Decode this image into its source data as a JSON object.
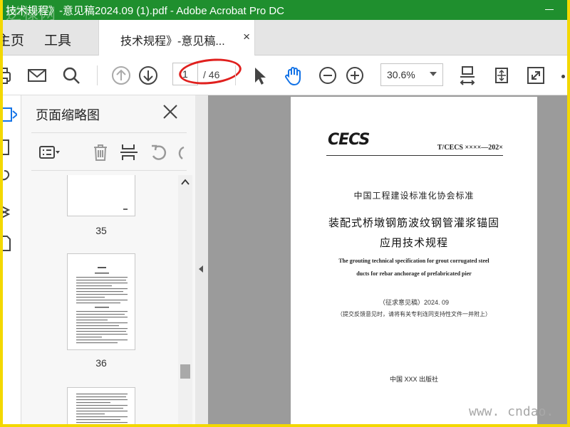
{
  "window": {
    "title": "技术规程》-意见稿2024.09 (1).pdf - Adobe Acrobat Pro DC",
    "watermark_top": "逆棣网"
  },
  "tabs": {
    "home": "主页",
    "tools": "工具",
    "document": "技术规程》-意见稿...",
    "close": "×"
  },
  "toolbar": {
    "current_page": "1",
    "total_pages": "/ 46",
    "zoom": "30.6%"
  },
  "thumbnail_panel": {
    "title": "页面缩略图",
    "pages": [
      {
        "number": "35"
      },
      {
        "number": "36"
      },
      {
        "number": ""
      }
    ]
  },
  "document": {
    "logo": "CECS",
    "standard_code": "T/CECS ××××—202×",
    "organization": "中国工程建设标准化协会标准",
    "title_line1": "装配式桥墩钢筋波纹钢管灌浆锚固",
    "title_line2": "应用技术规程",
    "english_line1": "The grouting technical specification for grout corrugated steel",
    "english_line2": "ducts for rebar anchorage of prefabricated pier",
    "draft_note": "（征求意见稿）2024. 09",
    "submission_note": "（提交反馈意见时，请将有关专利连同支持性文件一并附上）",
    "publisher": "中国 XXX 出版社"
  },
  "watermark_bottom": "www. cndao.",
  "colors": {
    "title_bar": "#1f8f2e",
    "frame": "#f3d800",
    "annotation": "#e0201e",
    "hand_tool": "#1473e6"
  }
}
